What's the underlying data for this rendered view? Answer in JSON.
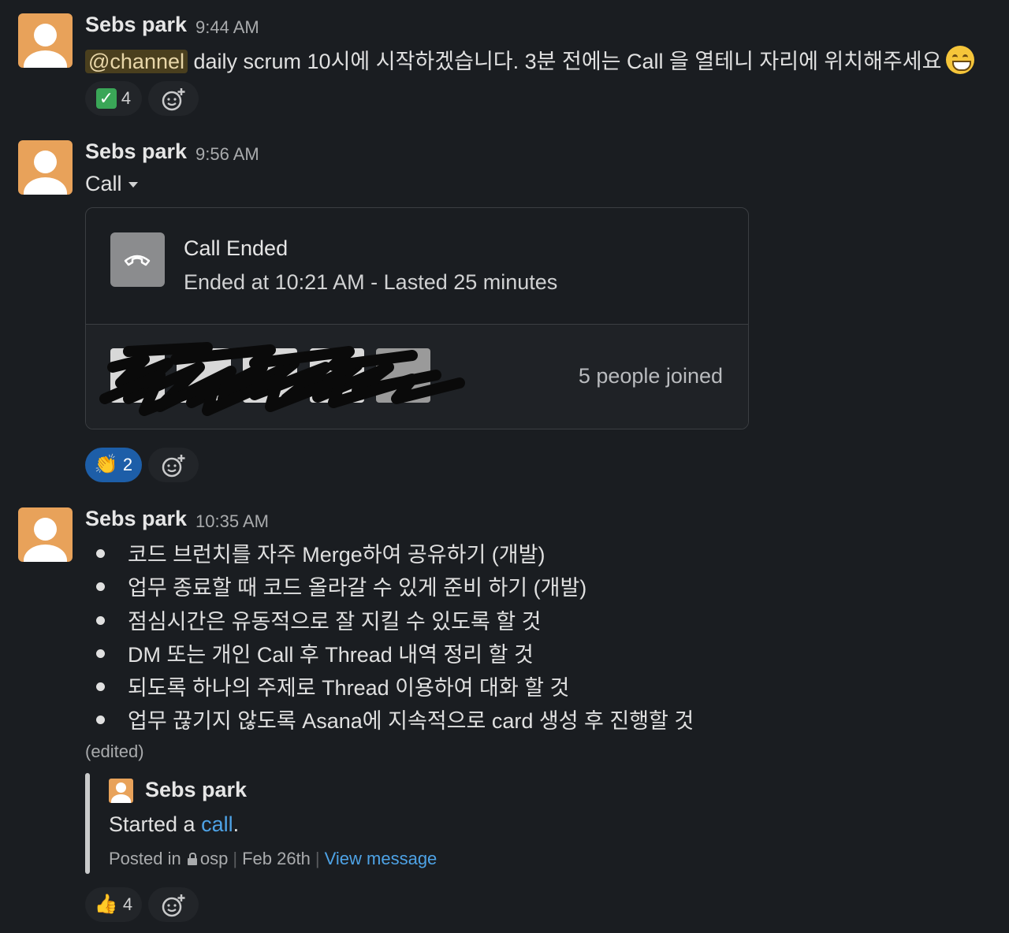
{
  "messages": [
    {
      "author": "Sebs park",
      "time": "9:44 AM",
      "mention": "@channel",
      "text": " daily scrum 10시에 시작하겠습니다. 3분 전에는 Call 을 열테니 자리에 위치해주세요",
      "emoji_icon": "grinning-face-icon",
      "reactions": [
        {
          "emoji": "check-mark-icon",
          "count": "4"
        }
      ]
    },
    {
      "author": "Sebs park",
      "time": "9:56 AM",
      "text": "Call",
      "call": {
        "title": "Call Ended",
        "subtitle": "Ended at 10:21 AM - Lasted 25 minutes",
        "participants_label": "5 people joined"
      },
      "reactions": [
        {
          "emoji": "clapping-hands-icon",
          "count": "2",
          "active": true
        }
      ]
    },
    {
      "author": "Sebs park",
      "time": "10:35 AM",
      "bullets": [
        "코드 브런치를 자주 Merge하여 공유하기 (개발)",
        "업무 종료할 때 코드 올라갈 수 있게 준비 하기 (개발)",
        "점심시간은 유동적으로 잘 지킬 수 있도록 할 것",
        "DM 또는 개인 Call 후 Thread 내역 정리 할 것",
        "되도록 하나의 주제로 Thread 이용하여 대화 할 것",
        "업무 끊기지 않도록  Asana에 지속적으로 card 생성 후 진행할 것"
      ],
      "edited": "(edited)",
      "quote": {
        "author": "Sebs park",
        "text_prefix": "Started a ",
        "link": "call",
        "text_suffix": ".",
        "posted_in": "Posted in",
        "channel": "osp",
        "date": "Feb 26th",
        "view": "View message"
      },
      "reactions": [
        {
          "emoji": "thumbs-up-icon",
          "count": "4"
        }
      ]
    }
  ]
}
